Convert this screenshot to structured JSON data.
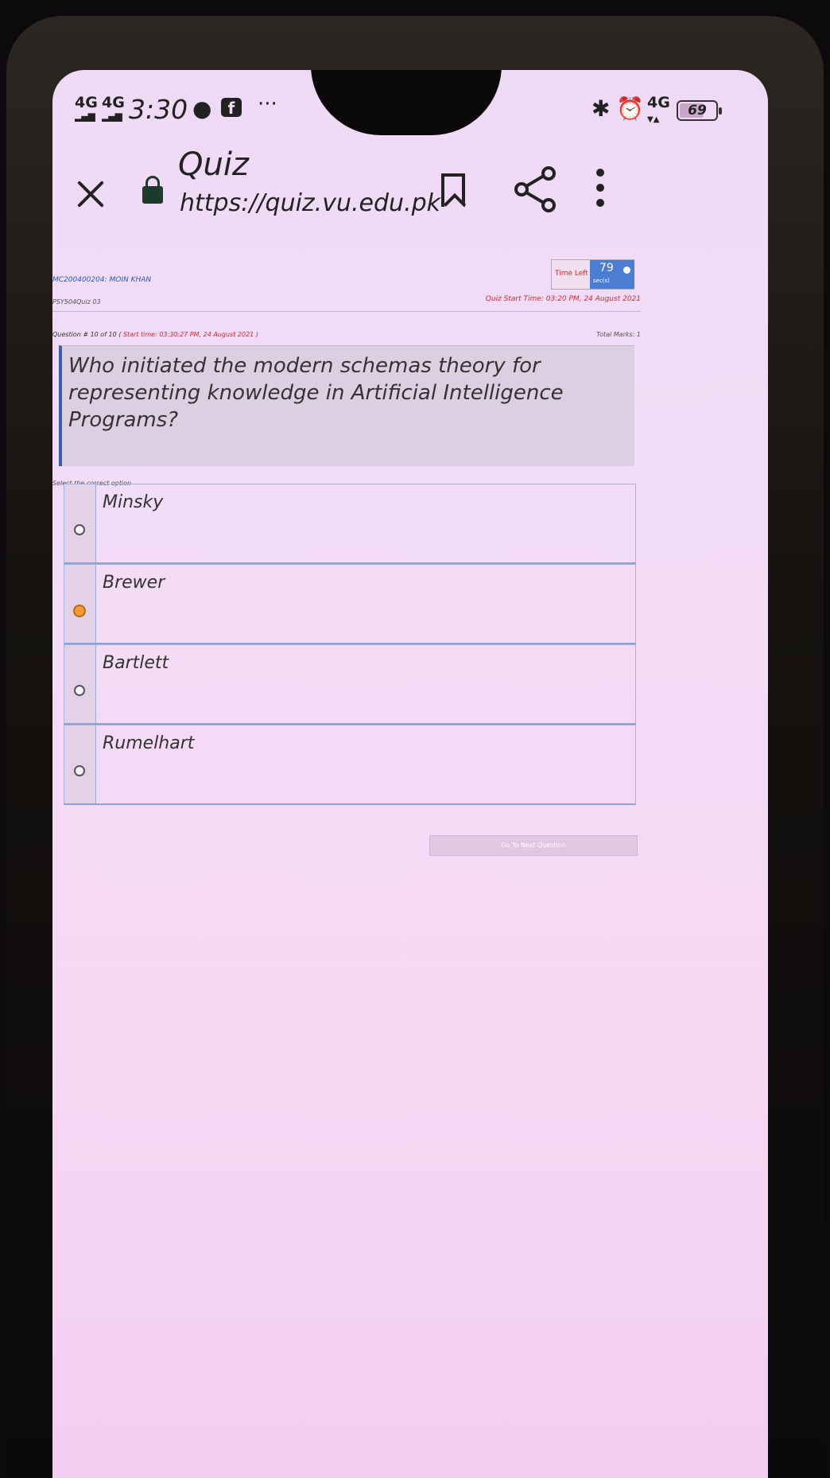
{
  "status_bar": {
    "network_1": "4G",
    "network_2": "4G",
    "time": "3:30",
    "more": "···",
    "network_3": "4G",
    "battery_percent": "69",
    "battery_level": 0.69
  },
  "browser": {
    "title": "Quiz",
    "url": "https://quiz.vu.edu.pk"
  },
  "quiz": {
    "student": "MC200400204: MOIN KHAN",
    "course": "PSY504Quiz 03",
    "time_left_label": "Time Left",
    "time_left_value": "79",
    "time_left_unit": "sec(s)",
    "quiz_start_time": "Quiz Start Time: 03:20 PM, 24 August 2021",
    "question_number": "Question # 10 of 10 (",
    "question_start_time": "Start time: 03:30:27 PM, 24 August 2021 )",
    "total_marks": "Total Marks: 1",
    "question": "Who initiated the modern schemas theory for representing knowledge in Artificial Intelligence Programs?",
    "select_prompt": "Select the correct option",
    "options": [
      {
        "label": "Minsky",
        "selected": false
      },
      {
        "label": "Brewer",
        "selected": true
      },
      {
        "label": "Bartlett",
        "selected": false
      },
      {
        "label": "Rumelhart",
        "selected": false
      }
    ],
    "next_button": "Go To Next Question"
  },
  "colors": {
    "accent_blue": "#4b7ed3",
    "warning_red": "#d0282e",
    "selected_radio": "#f39a36"
  }
}
